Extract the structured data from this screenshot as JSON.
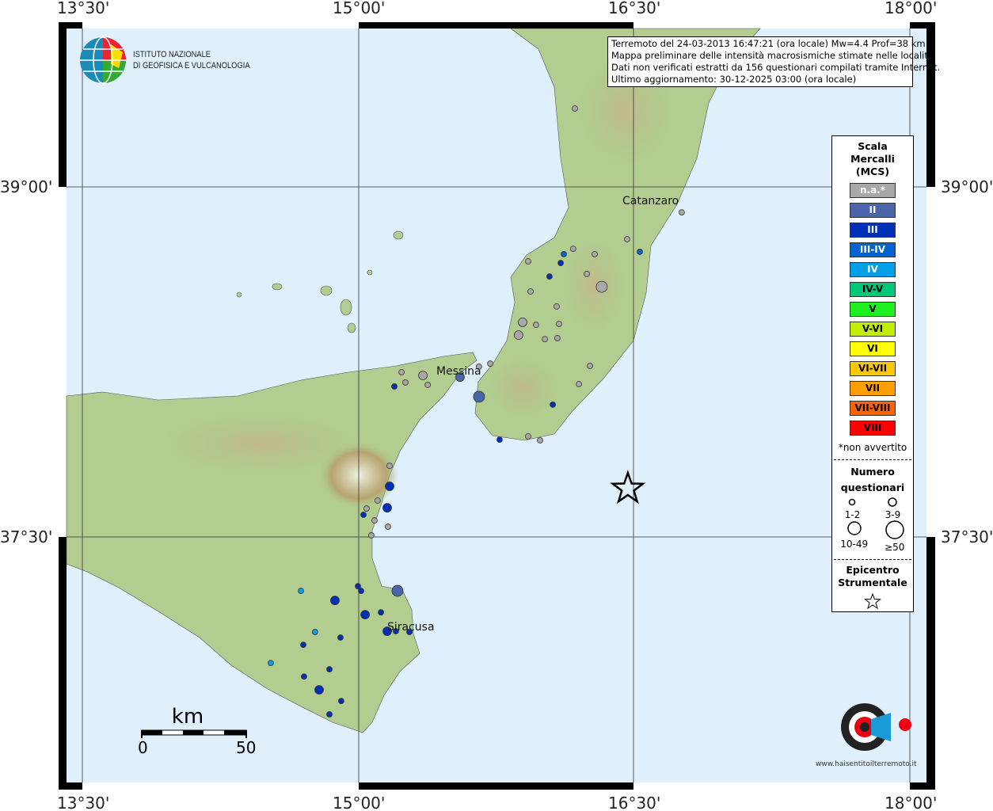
{
  "axes": {
    "lon_ticks": [
      "13°30'",
      "15°00'",
      "16°30'",
      "18°00'"
    ],
    "lat_ticks": [
      "39°00'",
      "37°30'"
    ]
  },
  "logo": {
    "line1": "ISTITUTO NAZIONALE",
    "line2": "DI GEOFISICA E VULCANOLOGIA"
  },
  "info": {
    "lines": [
      "Terremoto del 24-03-2013 16:47:21 (ora locale) Mw=4.4 Prof=38 km",
      "Mappa preliminare delle intensità macrosismiche stimate nelle località",
      "Dati non verificati estratti da 156 questionari compilati tramite Internet.",
      "Ultimo aggiornamento: 30-12-2025 03:00 (ora locale)"
    ]
  },
  "legend": {
    "title": [
      "Scala",
      "Mercalli",
      "(MCS)"
    ],
    "classes": [
      {
        "label": "n.a.*",
        "color": "#a8a8a8",
        "text": "#fff"
      },
      {
        "label": "II",
        "color": "#4a66a8",
        "text": "#fff"
      },
      {
        "label": "III",
        "color": "#0030b8",
        "text": "#fff"
      },
      {
        "label": "III-IV",
        "color": "#0064d0",
        "text": "#fff"
      },
      {
        "label": "IV",
        "color": "#00a0e8",
        "text": "#fff"
      },
      {
        "label": "IV-V",
        "color": "#00c878",
        "text": "#000"
      },
      {
        "label": "V",
        "color": "#20f020",
        "text": "#000"
      },
      {
        "label": "V-VI",
        "color": "#c0f000",
        "text": "#000"
      },
      {
        "label": "VI",
        "color": "#ffff00",
        "text": "#000"
      },
      {
        "label": "VI-VII",
        "color": "#ffc800",
        "text": "#000"
      },
      {
        "label": "VII",
        "color": "#ffa000",
        "text": "#000"
      },
      {
        "label": "VII-VIII",
        "color": "#ff6400",
        "text": "#000"
      },
      {
        "label": "VIII",
        "color": "#ff0000",
        "text": "#000"
      }
    ],
    "footnote": "*non avvertito",
    "count_title": [
      "Numero",
      "questionari"
    ],
    "counts": [
      "1-2",
      "3-9",
      "10-49",
      "≥50"
    ],
    "epi_title": [
      "Epicentro",
      "Strumentale"
    ]
  },
  "cities": [
    {
      "name": "Catanzaro",
      "lon": 16.59,
      "lat": 38.905
    },
    {
      "name": "Messina",
      "lon": 15.55,
      "lat": 38.19
    },
    {
      "name": "Siracusa",
      "lon": 15.28,
      "lat": 37.07
    }
  ],
  "epicenter": {
    "lon": 16.465,
    "lat": 37.707
  },
  "scale": {
    "unit": "km",
    "min": "0",
    "max": "50"
  },
  "site_logo": "www.haisentitoilterremoto.it",
  "points": [
    [
      16.177,
      39.336,
      "n.a.",
      1
    ],
    [
      15.923,
      38.681,
      "n.a.",
      1
    ],
    [
      16.168,
      38.735,
      "n.a.",
      1
    ],
    [
      16.285,
      38.712,
      "n.a.",
      1
    ],
    [
      16.242,
      38.627,
      "n.a.",
      1
    ],
    [
      16.323,
      38.572,
      "n.a.",
      3
    ],
    [
      16.461,
      38.776,
      "n.a.",
      1
    ],
    [
      16.758,
      38.891,
      "n.a.",
      1
    ],
    [
      15.936,
      38.552,
      "n.a.",
      1
    ],
    [
      16.078,
      38.488,
      "n.a.",
      1
    ],
    [
      15.893,
      38.42,
      "n.a.",
      2
    ],
    [
      15.871,
      38.365,
      "n.a.",
      2
    ],
    [
      15.966,
      38.409,
      "n.a.",
      1
    ],
    [
      16.091,
      38.413,
      "n.a.",
      1
    ],
    [
      16.014,
      38.348,
      "n.a.",
      1
    ],
    [
      16.082,
      38.352,
      "n.a.",
      1
    ],
    [
      16.259,
      38.233,
      "n.a.",
      1
    ],
    [
      16.199,
      38.155,
      "n.a.",
      1
    ],
    [
      15.923,
      37.931,
      "n.a.",
      1
    ],
    [
      15.988,
      37.914,
      "n.a.",
      1
    ],
    [
      15.717,
      38.243,
      "n.a.",
      1
    ],
    [
      15.656,
      38.23,
      "n.a.",
      1
    ],
    [
      15.351,
      38.192,
      "n.a.",
      2
    ],
    [
      15.377,
      38.152,
      "n.a.",
      1
    ],
    [
      15.235,
      38.206,
      "n.a.",
      1
    ],
    [
      15.256,
      38.162,
      "n.a.",
      1
    ],
    [
      16.1,
      38.674,
      "III",
      1
    ],
    [
      16.039,
      38.616,
      "III",
      1
    ],
    [
      16.057,
      38.067,
      "III",
      1
    ],
    [
      15.768,
      37.917,
      "III",
      1
    ],
    [
      15.196,
      38.145,
      "III",
      1
    ],
    [
      15.553,
      38.185,
      "II",
      2
    ],
    [
      15.656,
      38.101,
      "II",
      3
    ],
    [
      16.117,
      38.712,
      "III-IV",
      1
    ],
    [
      16.53,
      38.722,
      "III-IV",
      1
    ],
    [
      15.17,
      37.805,
      "n.a.",
      1
    ],
    [
      15.045,
      37.622,
      "n.a.",
      1
    ],
    [
      15.105,
      37.656,
      "n.a.",
      1
    ],
    [
      15.088,
      37.571,
      "n.a.",
      1
    ],
    [
      15.161,
      37.544,
      "n.a.",
      1
    ],
    [
      15.071,
      37.507,
      "n.a.",
      1
    ],
    [
      15.17,
      37.717,
      "III",
      2
    ],
    [
      15.157,
      37.625,
      "III",
      2
    ],
    [
      15.028,
      37.595,
      "III",
      1
    ],
    [
      14.998,
      37.289,
      "III",
      1
    ],
    [
      15.015,
      37.269,
      "III",
      1
    ],
    [
      14.873,
      37.228,
      "III",
      2
    ],
    [
      15.037,
      37.167,
      "III",
      2
    ],
    [
      15.123,
      37.177,
      "III",
      1
    ],
    [
      15.213,
      37.269,
      "II",
      3
    ],
    [
      15.157,
      37.096,
      "III",
      2
    ],
    [
      15.204,
      37.096,
      "III",
      1
    ],
    [
      15.278,
      37.093,
      "III",
      1
    ],
    [
      14.903,
      37.069,
      "III",
      1
    ],
    [
      14.701,
      37.038,
      "III",
      1
    ],
    [
      14.843,
      36.933,
      "III",
      1
    ],
    [
      14.705,
      36.902,
      "III",
      1
    ],
    [
      14.787,
      36.845,
      "III",
      2
    ],
    [
      14.907,
      36.797,
      "III",
      1
    ],
    [
      14.843,
      36.74,
      "III",
      1
    ],
    [
      14.688,
      37.269,
      "IV",
      1
    ],
    [
      14.765,
      37.093,
      "IV",
      1
    ],
    [
      14.524,
      36.96,
      "IV",
      1
    ]
  ]
}
